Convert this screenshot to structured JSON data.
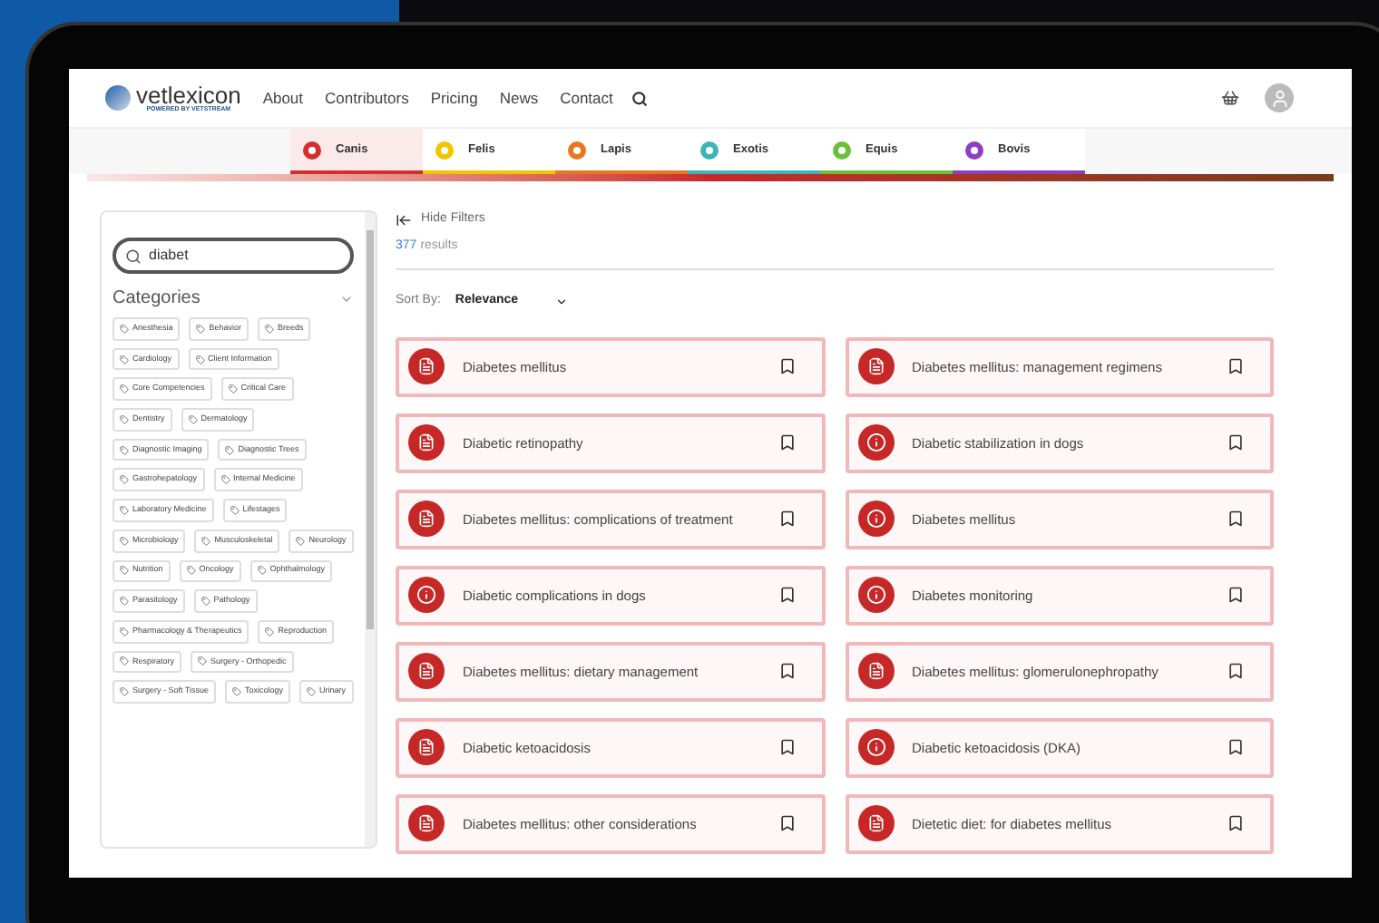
{
  "header": {
    "logo": "vetlexicon",
    "logo_tagline": "POWERED BY VETSTREAM",
    "nav": [
      "About",
      "Contributors",
      "Pricing",
      "News",
      "Contact"
    ]
  },
  "species_tabs": [
    {
      "label": "Canis",
      "color": "#d32f2f",
      "selected": true
    },
    {
      "label": "Felis",
      "color": "#f2c500",
      "selected": false
    },
    {
      "label": "Lapis",
      "color": "#e87722",
      "selected": false
    },
    {
      "label": "Exotis",
      "color": "#3fb3b8",
      "selected": false
    },
    {
      "label": "Equis",
      "color": "#6cbf3b",
      "selected": false
    },
    {
      "label": "Bovis",
      "color": "#8e3fbf",
      "selected": false
    }
  ],
  "filters": {
    "search": {
      "value": "diabet"
    },
    "categories_title": "Categories",
    "categories": [
      "Anesthesia",
      "Behavior",
      "Breeds",
      "Cardiology",
      "Client Information",
      "Core Competencies",
      "Critical Care",
      "Dentistry",
      "Dermatology",
      "Diagnostic Imaging",
      "Diagnostic Trees",
      "Gastrohepatology",
      "Internal Medicine",
      "Laboratory Medicine",
      "Lifestages",
      "Microbiology",
      "Musculoskeletal",
      "Neurology",
      "Nutrition",
      "Oncology",
      "Ophthalmology",
      "Parasitology",
      "Pathology",
      "Pharmacology & Therapeutics",
      "Reproduction",
      "Respiratory",
      "Surgery - Orthopedic",
      "Surgery - Soft Tissue",
      "Toxicology",
      "Urinary"
    ]
  },
  "results": {
    "hide_filters": "Hide Filters",
    "count": "377",
    "count_label": "results",
    "sort_label": "Sort By:",
    "sort_value": "Relevance",
    "items": [
      {
        "kind": "article",
        "title": "Diabetes mellitus"
      },
      {
        "kind": "article",
        "title": "Diabetes mellitus: management regimens"
      },
      {
        "kind": "article",
        "title": "Diabetic retinopathy"
      },
      {
        "kind": "info",
        "title": "Diabetic stabilization in dogs"
      },
      {
        "kind": "article",
        "title": "Diabetes mellitus: complications of treatment"
      },
      {
        "kind": "info",
        "title": "Diabetes mellitus"
      },
      {
        "kind": "info",
        "title": "Diabetic complications in dogs"
      },
      {
        "kind": "info",
        "title": "Diabetes monitoring"
      },
      {
        "kind": "article",
        "title": "Diabetes mellitus: dietary management"
      },
      {
        "kind": "article",
        "title": "Diabetes mellitus: glomerulonephropathy"
      },
      {
        "kind": "article",
        "title": "Diabetic ketoacidosis"
      },
      {
        "kind": "info",
        "title": "Diabetic ketoacidosis (DKA)"
      },
      {
        "kind": "article",
        "title": "Diabetes mellitus: other considerations"
      },
      {
        "kind": "article",
        "title": "Dietetic diet: for diabetes mellitus"
      }
    ]
  }
}
